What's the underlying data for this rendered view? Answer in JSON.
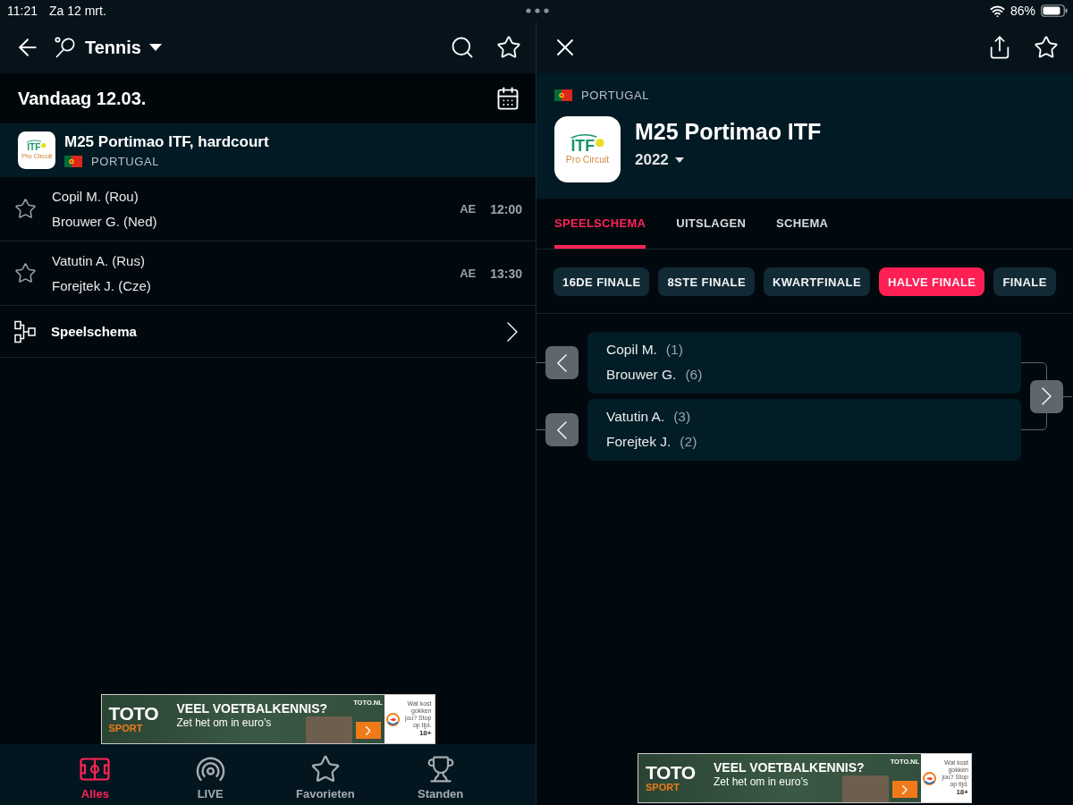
{
  "status_bar": {
    "time": "11:21",
    "date": "Za 12 mrt.",
    "battery": "86%"
  },
  "left_pane": {
    "header": {
      "sport": "Tennis"
    },
    "date_bar": {
      "label": "Vandaag 12.03."
    },
    "tournament": {
      "logo": {
        "wordmark": "ITF",
        "subtitle": "Pro Circuit"
      },
      "name": "M25 Portimao ITF, hardcourt",
      "country": "PORTUGAL"
    },
    "matches": [
      {
        "favorite": false,
        "players": [
          "Copil M. (Rou)",
          "Brouwer G. (Ned)"
        ],
        "status": "AE",
        "time": "12:00"
      },
      {
        "favorite": false,
        "players": [
          "Vatutin A. (Rus)",
          "Forejtek J. (Cze)"
        ],
        "status": "AE",
        "time": "13:30"
      }
    ],
    "bracket_link": {
      "label": "Speelschema"
    },
    "ad": {
      "brand": "TOTO",
      "brand_tagline": "SPORT",
      "headline": "VEEL VOETBALKENNIS?",
      "subline": "Zet het om in euro’s",
      "url": "TOTO.NL",
      "disclaimer": "Wat kost gokken jou? Stop op tijd.",
      "age": "18+"
    },
    "bottom_nav": [
      {
        "kind": "field",
        "label": "Alles",
        "selected": true
      },
      {
        "kind": "live",
        "label": "LIVE",
        "selected": false
      },
      {
        "kind": "star",
        "label": "Favorieten",
        "selected": false
      },
      {
        "kind": "trophy",
        "label": "Standen",
        "selected": false
      }
    ]
  },
  "right_pane": {
    "tournament": {
      "country": "PORTUGAL",
      "logo": {
        "wordmark": "ITF",
        "subtitle": "Pro Circuit"
      },
      "name": "M25 Portimao ITF",
      "season": "2022"
    },
    "tabs": [
      {
        "label": "SPEELSCHEMA",
        "selected": true
      },
      {
        "label": "UITSLAGEN",
        "selected": false
      },
      {
        "label": "SCHEMA",
        "selected": false
      }
    ],
    "rounds": [
      {
        "label": "16DE FINALE",
        "selected": false
      },
      {
        "label": "8STE FINALE",
        "selected": false
      },
      {
        "label": "KWARTFINALE",
        "selected": false
      },
      {
        "label": "HALVE FINALE",
        "selected": true
      },
      {
        "label": "FINALE",
        "selected": false
      }
    ],
    "bracket": [
      {
        "players": [
          {
            "name": "Copil M.",
            "seed": "(1)"
          },
          {
            "name": "Brouwer G.",
            "seed": "(6)"
          }
        ]
      },
      {
        "players": [
          {
            "name": "Vatutin A.",
            "seed": "(3)"
          },
          {
            "name": "Forejtek J.",
            "seed": "(2)"
          }
        ]
      }
    ],
    "ad": {
      "brand": "TOTO",
      "brand_tagline": "SPORT",
      "headline": "VEEL VOETBALKENNIS?",
      "subline": "Zet het om in euro’s",
      "url": "TOTO.NL",
      "disclaimer": "Wat kost gokken jou? Stop op tijd.",
      "age": "18+"
    }
  }
}
